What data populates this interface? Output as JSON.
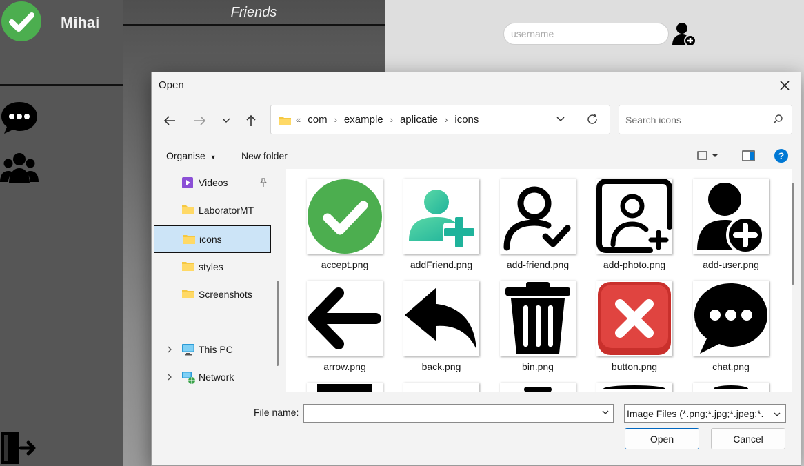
{
  "app": {
    "user_name": "Mihai",
    "friends_title": "Friends",
    "username_placeholder": "username",
    "status_color": "#4cae4f"
  },
  "dialog": {
    "title": "Open",
    "breadcrumb": [
      "com",
      "example",
      "aplicatie",
      "icons"
    ],
    "breadcrumb_prefix": "«",
    "search_placeholder": "Search icons",
    "toolbar": {
      "organise_label": "Organise",
      "new_folder_label": "New folder"
    },
    "nav": {
      "videos": "Videos",
      "laboratormt": "LaboratorMT",
      "icons": "icons",
      "styles": "styles",
      "screenshots": "Screenshots",
      "this_pc": "This PC",
      "network": "Network"
    },
    "files": [
      {
        "name": "accept.png",
        "icon": "green-check-icon"
      },
      {
        "name": "addFriend.png",
        "icon": "teal-add-user-icon"
      },
      {
        "name": "add-friend.png",
        "icon": "user-check-outline-icon"
      },
      {
        "name": "add-photo.png",
        "icon": "add-photo-icon"
      },
      {
        "name": "add-user.png",
        "icon": "add-user-filled-icon"
      },
      {
        "name": "arrow.png",
        "icon": "left-arrow-icon"
      },
      {
        "name": "back.png",
        "icon": "reply-arrow-icon"
      },
      {
        "name": "bin.png",
        "icon": "trash-bin-icon"
      },
      {
        "name": "button.png",
        "icon": "red-x-button-icon"
      },
      {
        "name": "chat.png",
        "icon": "chat-bubble-icon"
      }
    ],
    "footer": {
      "file_name_label": "File name:",
      "file_name_value": "",
      "filter_value": "Image Files (*.png;*.jpg;*.jpeg;*.",
      "open_label": "Open",
      "cancel_label": "Cancel"
    },
    "colors": {
      "selected_nav": "#cce4f7",
      "primary_border": "#0067c0",
      "help_blue": "#0078d4"
    }
  }
}
